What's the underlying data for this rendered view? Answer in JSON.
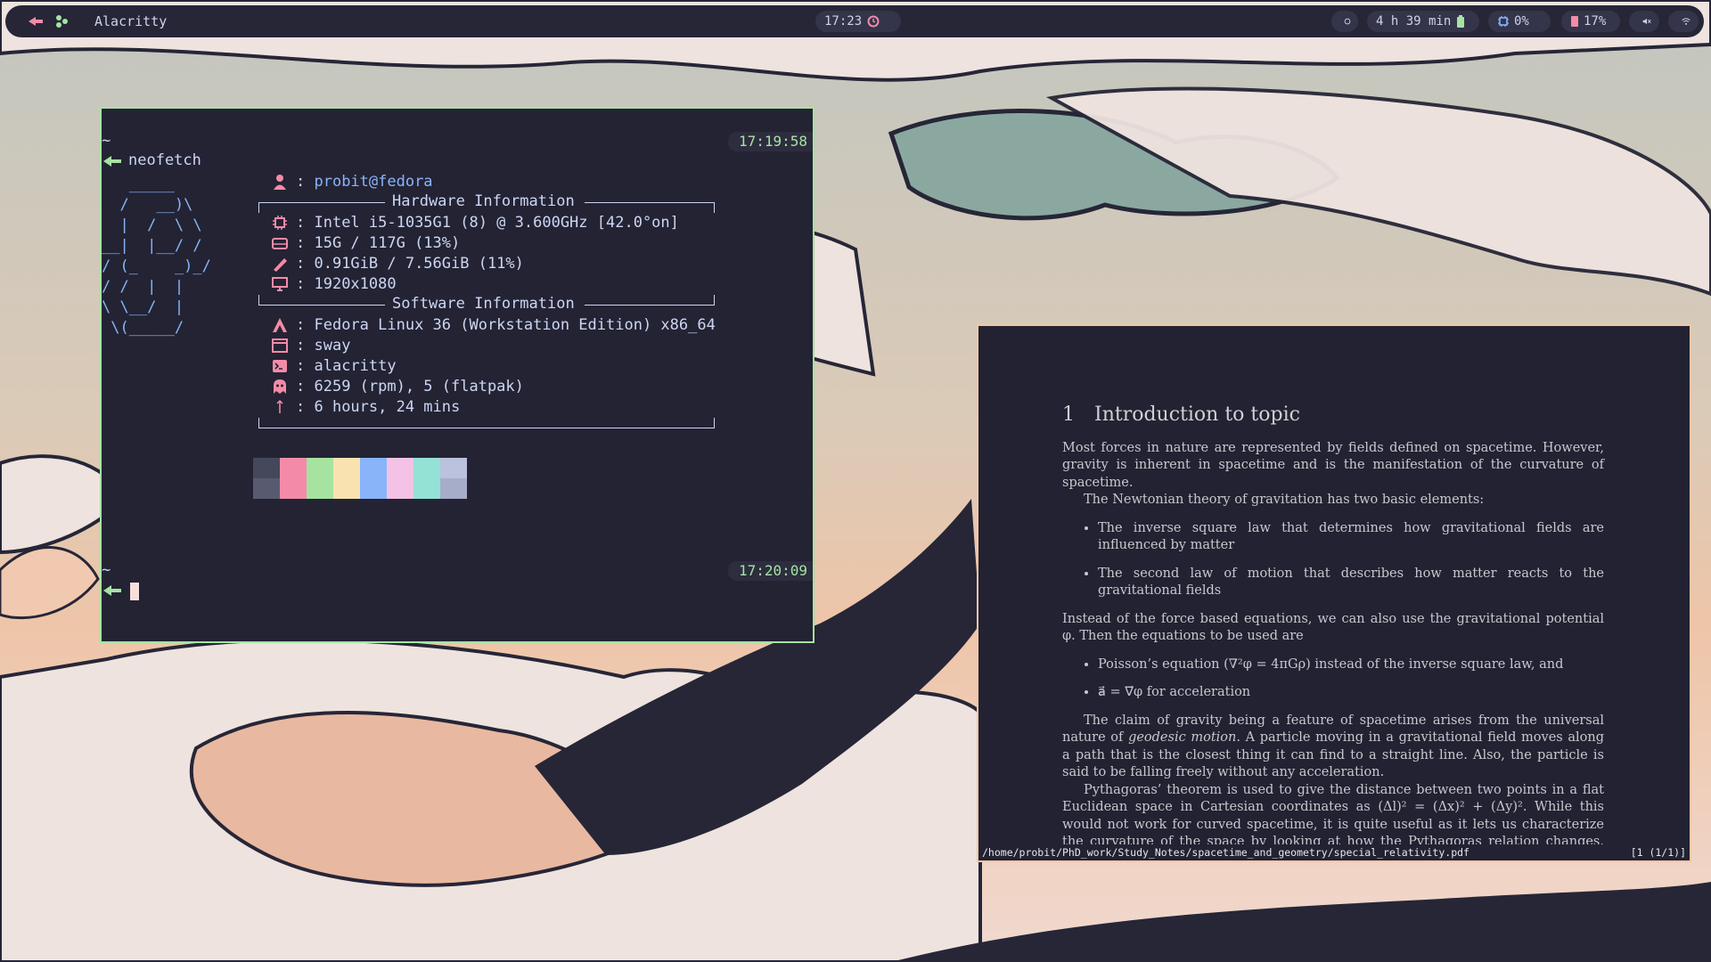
{
  "topbar": {
    "window_title": "Alacritty",
    "clock": "17:23",
    "battery_time": "4 h 39 min",
    "cpu": "0%",
    "memory": "17%",
    "workspace_icons": [
      "sway-icon",
      "flatpak-icon"
    ],
    "status_icons": [
      "idle-inhibitor-icon",
      "battery-icon",
      "cpu-icon",
      "memory-icon",
      "volume-muted-icon",
      "wifi-icon"
    ]
  },
  "terminal": {
    "tilde1": "~",
    "command": "neofetch",
    "timestamp1": "17:19:58",
    "ascii_logo": "   _____\n  /   __)\\\n  |  /  \\ \\\n__|  |__/ /\n/ (_    _)_/\n/ /  |  |\n\\ \\__/  |\n \\(_____/",
    "user": "probit@fedora",
    "hardware_heading": "Hardware Information",
    "software_heading": "Software Information",
    "cpu": "Intel i5-1035G1 (8) @ 3.600GHz [42.0°on]",
    "disk": "15G / 117G (13%)",
    "memory": "0.91GiB / 7.56GiB (11%)",
    "resolution": "1920x1080",
    "os": "Fedora Linux 36 (Workstation Edition) x86_64",
    "wm": "sway",
    "terminal": "alacritty",
    "packages": "6259 (rpm), 5 (flatpak)",
    "uptime": "6 hours, 24 mins",
    "tilde2": "~",
    "timestamp2": "17:20:09",
    "palette_top": [
      "#45475a",
      "#f38ba8",
      "#a6e3a1",
      "#f9e2af",
      "#89b4fa",
      "#f5c2e7",
      "#94e2d5",
      "#bac2de"
    ],
    "palette_bottom": [
      "#585b70",
      "#f38ba8",
      "#a6e3a1",
      "#f9e2af",
      "#89b4fa",
      "#f5c2e7",
      "#94e2d5",
      "#a6adc8"
    ],
    "accent": "#a6e3a1"
  },
  "pdf": {
    "section_number": "1",
    "section_title": "Introduction to topic",
    "p1": "Most forces in nature are represented by fields defined on spacetime. However, gravity is inherent in spacetime and is the manifestation of the curvature of spacetime.",
    "p2": "The Newtonian theory of gravitation has two basic elements:",
    "bullet1": "The inverse square law that determines how gravitational fields are influenced by matter",
    "bullet2": "The second law of motion that describes how matter reacts to the gravitational fields",
    "p3": "Instead of the force based equations, we can also use the gravitational potential φ. Then the equations to be used are",
    "bullet3": "Poisson’s equation (∇²φ = 4πGρ) instead of the inverse square law, and",
    "bullet4": "a⃗ = ∇⃗φ for acceleration",
    "p4a": "The claim of gravity being a feature of spacetime arises from the universal nature of ",
    "p4_em": "geodesic motion",
    "p4b": ". A particle moving in a gravitational field moves along a path that is the closest thing it can find to a straight line. Also, the particle is said to be falling freely without any acceleration.",
    "p5": "Pythagoras’ theorem is used to give the distance between two points in a flat Euclidean space in Cartesian coordinates as (Δl)² = (Δx)² + (Δy)². While this would not work for curved spacetime, it is quite useful as it lets us characterize the curvature of the space by looking at how the Pythagoras relation changes. This information is stored in the",
    "file_path": "/home/probit/PhD_work/Study_Notes/spacetime_and_geometry/special_relativity.pdf",
    "page_indicator": "[1 (1/1)]"
  }
}
